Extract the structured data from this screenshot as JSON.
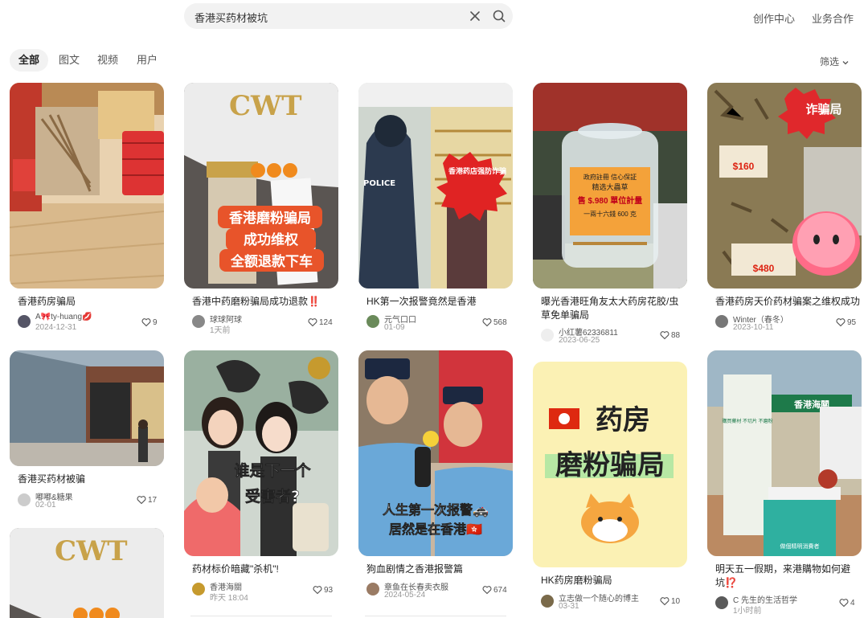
{
  "search": {
    "query": "香港买药材被坑"
  },
  "top_links": {
    "creator": "创作中心",
    "business": "业务合作"
  },
  "tabs": [
    "全部",
    "图文",
    "视频",
    "用户"
  ],
  "filter_label": "筛选",
  "cards": [
    {
      "title": "香港药房骗局",
      "author": "A🎀ty-huang💋",
      "date": "2024-12-31",
      "likes": "9"
    },
    {
      "title": "香港中药磨粉骗局成功退款‼️",
      "author": "球球阿球",
      "date": "1天前",
      "likes": "124",
      "overlay": {
        "badge": "CWT",
        "lines": [
          "香港磨粉骗局",
          "成功维权",
          "全额退款下车"
        ]
      }
    },
    {
      "title": "HK第一次报警竟然是香港",
      "author": "元气口口",
      "date": "01-09",
      "likes": "568",
      "overlay": {
        "sticker": "香港药店强防诈骗",
        "police": "POLICE"
      }
    },
    {
      "title": "曝光香港旺角友太大药房花胶/虫草免单骗局",
      "author": "小红薯62336811",
      "date": "2023-06-25",
      "likes": "88",
      "overlay": {
        "jar_lines": [
          "政府註冊 信心保証",
          "精选大蟲草",
          "售 $.980 單位計量",
          "一兩十六錢 600 克"
        ]
      }
    },
    {
      "title": "香港药房天价药材骗案之维权成功",
      "author": "Winter（春冬）",
      "date": "2023-10-11",
      "likes": "95",
      "overlay": {
        "sticker": "诈骗局",
        "prices": [
          "$160",
          "$480"
        ]
      }
    },
    {
      "title": "香港买药材被骗",
      "author": "嘟嘟&糖果",
      "date": "02-01",
      "likes": "17"
    },
    {
      "title": "药材标价暗藏\"杀机\"!",
      "author": "香港海關",
      "date": "昨天 18:04",
      "likes": "93",
      "overlay": {
        "lines": [
          "谁是下一个",
          "受害者?"
        ]
      }
    },
    {
      "title": "狗血剧情之香港报警篇",
      "author": "章鱼在长春卖衣服",
      "date": "2024-05-24",
      "likes": "674",
      "overlay": {
        "lines": [
          "人生第一次报警🚓",
          "居然是在香港🇭🇰"
        ]
      }
    },
    {
      "title": "HK药房磨粉骗局",
      "author": "立志做一个随心的博主",
      "date": "03-31",
      "likes": "10",
      "overlay": {
        "lines": [
          "药房",
          "磨粉骗局"
        ]
      }
    },
    {
      "title": "明天五一假期，来港購物如何避坑⁉️",
      "author": "C 先生的生活哲学",
      "date": "1小时前",
      "likes": "4",
      "overlay": {
        "banner": "香港海關",
        "poster": "購買藥材 不切片 不磨粉",
        "sign": "做個精明消費者"
      }
    },
    {
      "title": "",
      "author": "",
      "date": "",
      "likes": "",
      "overlay": {
        "badge": "CWT"
      }
    }
  ],
  "colors": {
    "accent_red": "#ff2442",
    "text_dark": "#222222",
    "muted": "#999999",
    "chip_bg": "#f2f2f2"
  }
}
